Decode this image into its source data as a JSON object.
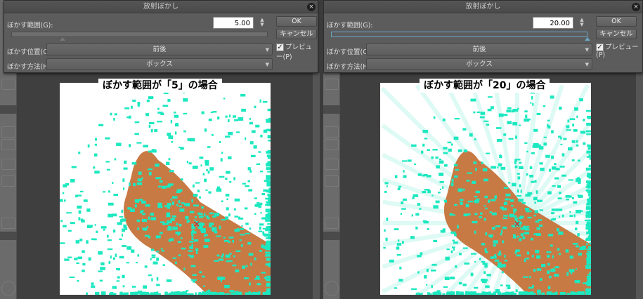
{
  "panels": [
    {
      "dialog_title": "放射ぼかし",
      "range_label": "ぼかす範囲(G):",
      "range_value": "5.00",
      "range_fraction": 0.2,
      "position_label": "ぼかす位置(O):",
      "position_value": "前後",
      "method_label": "ぼかす方法(H):",
      "method_value": "ボックス",
      "ok": "OK",
      "cancel": "キャンセル",
      "preview": "プレビュー(P)",
      "preview_checked": true,
      "caption": "ぼかす範囲が「5」の場合",
      "blur": 5
    },
    {
      "dialog_title": "放射ぼかし",
      "range_label": "ぼかす範囲(G):",
      "range_value": "20.00",
      "range_fraction": 1.0,
      "position_label": "ぼかす位置(O):",
      "position_value": "前後",
      "method_label": "ぼかす方法(H):",
      "method_value": "ボックス",
      "ok": "OK",
      "cancel": "キャンセル",
      "preview": "プレビュー(P)",
      "preview_checked": true,
      "caption": "ぼかす範囲が「20」の場合",
      "blur": 20
    }
  ],
  "icons": {
    "close": "×",
    "check": "✓",
    "spin": "▲▼",
    "dropdown": "▼"
  },
  "colors": {
    "cyan": "#1de8c0",
    "brown": "#c87a44",
    "slider_active": "#6aa6c8"
  }
}
